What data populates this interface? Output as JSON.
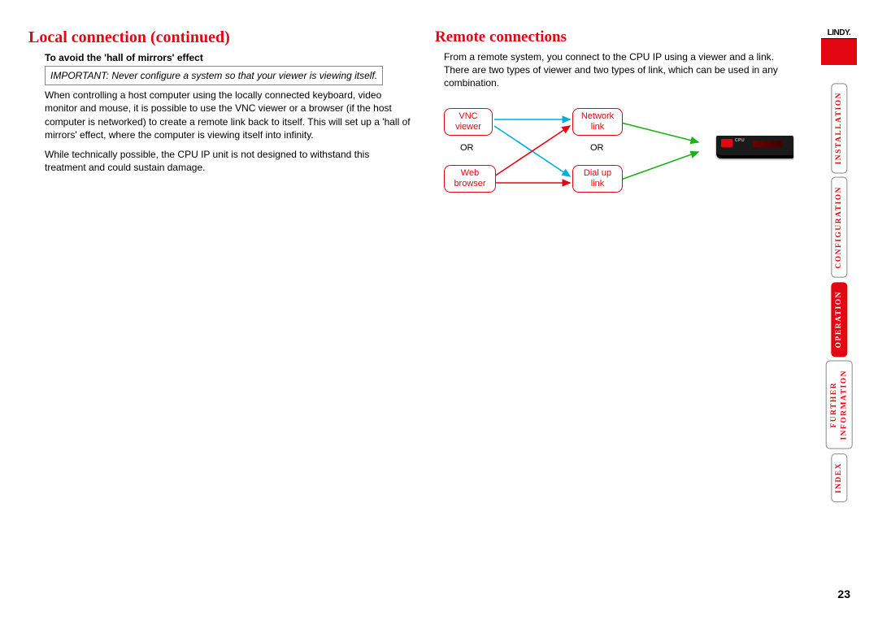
{
  "left_col": {
    "title": "Local connection (continued)",
    "subhead": "To avoid the 'hall of mirrors' effect",
    "important": "IMPORTANT: Never configure a system so that your viewer is viewing itself.",
    "para1": "When controlling a host computer using the locally connected keyboard, video monitor and mouse, it is possible to use the VNC viewer or a browser (if the host computer is networked) to create a remote link back to itself. This will set up a 'hall of mirrors' effect, where the computer is viewing itself into infinity.",
    "para2": "While technically possible, the CPU IP unit is not designed to withstand this treatment and could sustain damage."
  },
  "right_col": {
    "title": "Remote connections",
    "para": "From a remote system, you connect to the CPU IP using a viewer and a link. There are two types of viewer and two types of link, which can be used in any combination."
  },
  "diagram": {
    "box1_line1": "VNC",
    "box1_line2": "viewer",
    "or1": "OR",
    "box2_line1": "Web",
    "box2_line2": "browser",
    "box3_line1": "Network",
    "box3_line2": "link",
    "or2": "OR",
    "box4_line1": "Dial up",
    "box4_line2": "link",
    "device_label": "CPU"
  },
  "nav": {
    "logo": "LINDY.",
    "items": [
      {
        "label": "INSTALLATION"
      },
      {
        "label": "CONFIGURATION"
      },
      {
        "label": "OPERATION"
      },
      {
        "label": "FURTHER\nINFORMATION"
      },
      {
        "label": "INDEX"
      }
    ]
  },
  "page_number": "23"
}
